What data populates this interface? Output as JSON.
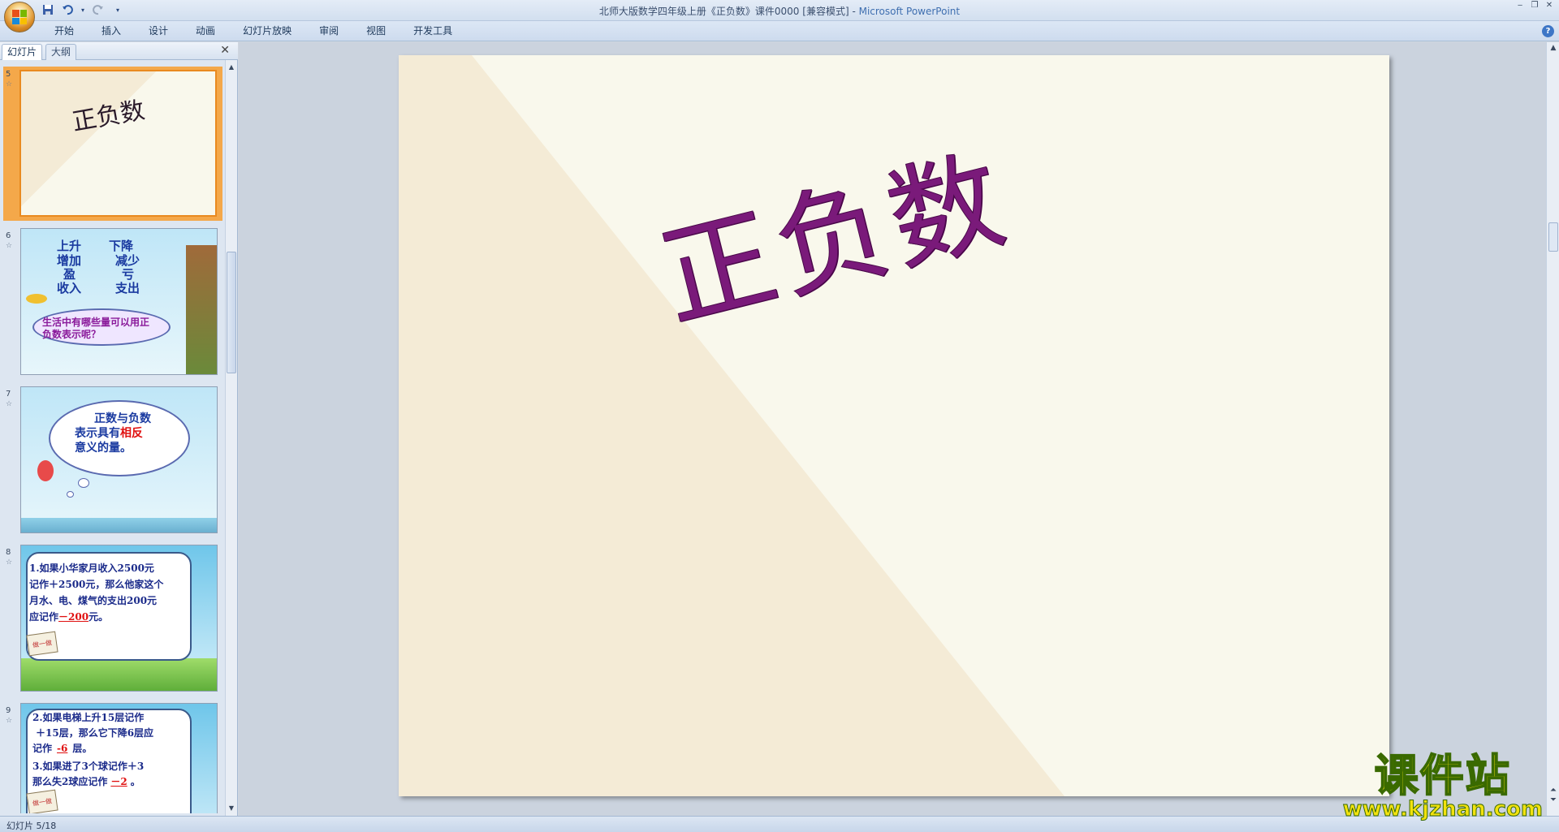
{
  "window": {
    "title_doc": "北师大版数学四年级上册《正负数》课件0000 [兼容模式] - ",
    "title_app": "Microsoft PowerPoint",
    "controls": [
      "‒",
      "❐",
      "✕"
    ]
  },
  "qat": {
    "save": "save-icon",
    "undo": "undo-icon",
    "redo": "redo-icon",
    "customize": "▾"
  },
  "ribbon": {
    "tabs": [
      "开始",
      "插入",
      "设计",
      "动画",
      "幻灯片放映",
      "审阅",
      "视图",
      "开发工具"
    ],
    "help": "?"
  },
  "pane": {
    "tab_slides": "幻灯片",
    "tab_outline": "大纲",
    "close": "✕"
  },
  "thumbs": {
    "s5": {
      "num": "5",
      "title": "正负数"
    },
    "s6": {
      "num": "6",
      "l1a": "上升",
      "l1b": "下降",
      "l2a": "增加",
      "l2b": "减少",
      "l3a": "盈",
      "l3b": "亏",
      "l4a": "收入",
      "l4b": "支出",
      "q1": "生活中有哪些量可以用正",
      "q2": "负数表示呢？"
    },
    "s7": {
      "num": "7",
      "l1": "正数与负数",
      "l2a": "表示具有",
      "l2b": "相反",
      "l3": "意义的量。"
    },
    "s8": {
      "num": "8",
      "l1": "1.如果小华家月收入2500元",
      "l2": "记作＋2500元，那么他家这个",
      "l3": "月水、电、煤气的支出200元",
      "l4a": "应记作",
      "l4b": "－200",
      "l4c": "元。",
      "sign": "做一做"
    },
    "s9": {
      "num": "9",
      "l1": "2.如果电梯上升15层记作",
      "l2": "＋15层，那么它下降6层应",
      "l3a": "记作",
      "l3b": "-6",
      "l3c": "层。",
      "l4": "3.如果进了3个球记作＋3",
      "l5a": "那么失2球应记作",
      "l5b": "－2",
      "l5c": "。",
      "sign": "做一做"
    }
  },
  "slide": {
    "title": "正负数"
  },
  "status": {
    "slide_info": "幻灯片 5/18"
  },
  "watermark": {
    "main": "课件站",
    "url": "www.kjzhan.com"
  }
}
